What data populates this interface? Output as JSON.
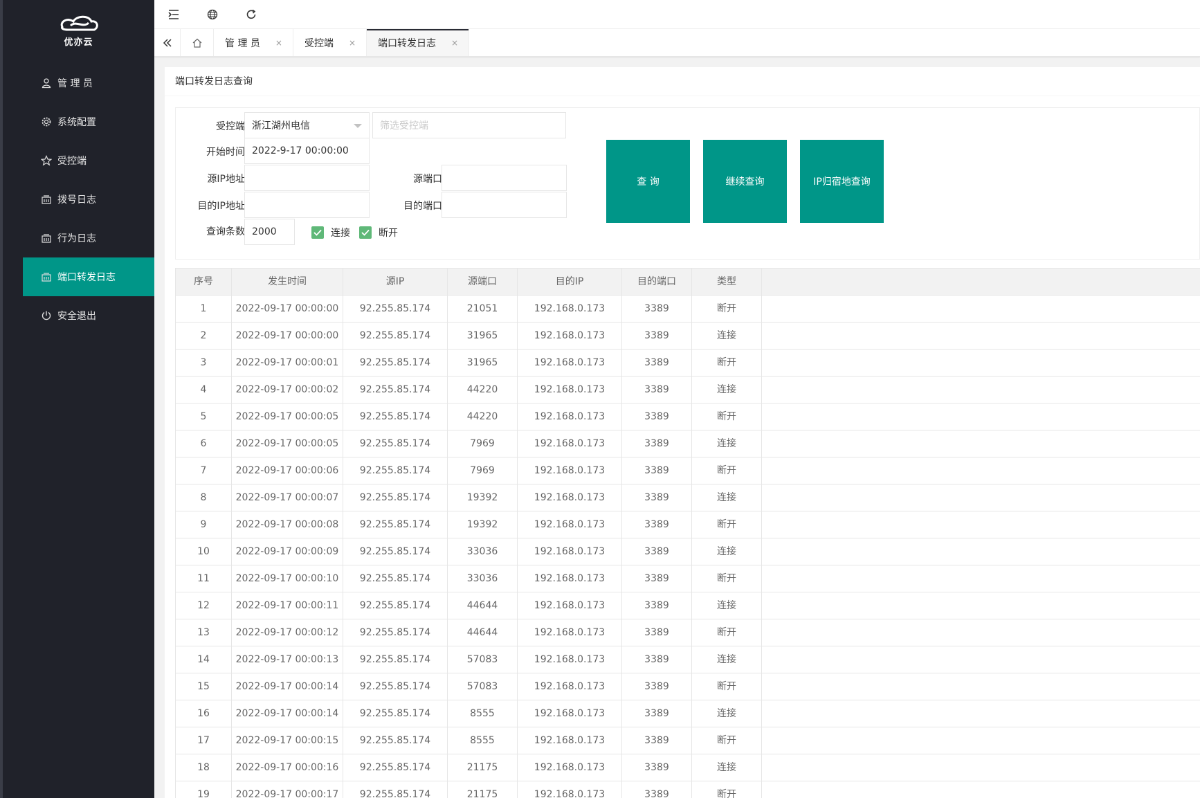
{
  "app": {
    "logo_text": "优亦云"
  },
  "sidebar": {
    "items": [
      {
        "label": "管 理 员",
        "icon": "user-icon",
        "active": false
      },
      {
        "label": "系统配置",
        "icon": "gear-icon",
        "active": false
      },
      {
        "label": "受控端",
        "icon": "star-icon",
        "active": false
      },
      {
        "label": "拨号日志",
        "icon": "log-icon",
        "active": false
      },
      {
        "label": "行为日志",
        "icon": "log-icon",
        "active": false
      },
      {
        "label": "端口转发日志",
        "icon": "log-icon",
        "active": true
      },
      {
        "label": "安全退出",
        "icon": "power-icon",
        "active": false
      }
    ]
  },
  "header": {
    "icons": [
      "menu-fold-icon",
      "globe-icon",
      "refresh-icon"
    ]
  },
  "tabs": [
    {
      "label": "管 理 员",
      "active": false
    },
    {
      "label": "受控端",
      "active": false
    },
    {
      "label": "端口转发日志",
      "active": true
    }
  ],
  "tab_close": "×",
  "card": {
    "title": "端口转发日志查询"
  },
  "filter": {
    "client_label": "受控端",
    "client_value": "浙江湖州电信",
    "client_filter_placeholder": "筛选受控端",
    "start_label": "开始时间",
    "start_value": "2022-9-17 00:00:00",
    "src_ip_label": "源IP地址",
    "src_ip_value": "",
    "src_port_label": "源端口",
    "src_port_value": "",
    "dst_ip_label": "目的IP地址",
    "dst_ip_value": "",
    "dst_port_label": "目的端口",
    "dst_port_value": "",
    "count_label": "查询条数",
    "count_value": "2000",
    "chk_connect_label": "连接",
    "chk_connect_checked": true,
    "chk_disconnect_label": "断开",
    "chk_disconnect_checked": true,
    "btn_query": "查 询",
    "btn_continue": "继续查询",
    "btn_ip_location": "IP归宿地查询"
  },
  "colors": {
    "accent": "#009688",
    "sidebar": "#20222a",
    "checkbox": "#5fb878"
  },
  "table": {
    "columns": [
      "序号",
      "发生时间",
      "源IP",
      "源端口",
      "目的IP",
      "目的端口",
      "类型"
    ],
    "rows": [
      [
        "1",
        "2022-09-17 00:00:00",
        "92.255.85.174",
        "21051",
        "192.168.0.173",
        "3389",
        "断开"
      ],
      [
        "2",
        "2022-09-17 00:00:00",
        "92.255.85.174",
        "31965",
        "192.168.0.173",
        "3389",
        "连接"
      ],
      [
        "3",
        "2022-09-17 00:00:01",
        "92.255.85.174",
        "31965",
        "192.168.0.173",
        "3389",
        "断开"
      ],
      [
        "4",
        "2022-09-17 00:00:02",
        "92.255.85.174",
        "44220",
        "192.168.0.173",
        "3389",
        "连接"
      ],
      [
        "5",
        "2022-09-17 00:00:05",
        "92.255.85.174",
        "44220",
        "192.168.0.173",
        "3389",
        "断开"
      ],
      [
        "6",
        "2022-09-17 00:00:05",
        "92.255.85.174",
        "7969",
        "192.168.0.173",
        "3389",
        "连接"
      ],
      [
        "7",
        "2022-09-17 00:00:06",
        "92.255.85.174",
        "7969",
        "192.168.0.173",
        "3389",
        "断开"
      ],
      [
        "8",
        "2022-09-17 00:00:07",
        "92.255.85.174",
        "19392",
        "192.168.0.173",
        "3389",
        "连接"
      ],
      [
        "9",
        "2022-09-17 00:00:08",
        "92.255.85.174",
        "19392",
        "192.168.0.173",
        "3389",
        "断开"
      ],
      [
        "10",
        "2022-09-17 00:00:09",
        "92.255.85.174",
        "33036",
        "192.168.0.173",
        "3389",
        "连接"
      ],
      [
        "11",
        "2022-09-17 00:00:10",
        "92.255.85.174",
        "33036",
        "192.168.0.173",
        "3389",
        "断开"
      ],
      [
        "12",
        "2022-09-17 00:00:11",
        "92.255.85.174",
        "44644",
        "192.168.0.173",
        "3389",
        "连接"
      ],
      [
        "13",
        "2022-09-17 00:00:12",
        "92.255.85.174",
        "44644",
        "192.168.0.173",
        "3389",
        "断开"
      ],
      [
        "14",
        "2022-09-17 00:00:13",
        "92.255.85.174",
        "57083",
        "192.168.0.173",
        "3389",
        "连接"
      ],
      [
        "15",
        "2022-09-17 00:00:14",
        "92.255.85.174",
        "57083",
        "192.168.0.173",
        "3389",
        "断开"
      ],
      [
        "16",
        "2022-09-17 00:00:14",
        "92.255.85.174",
        "8555",
        "192.168.0.173",
        "3389",
        "连接"
      ],
      [
        "17",
        "2022-09-17 00:00:15",
        "92.255.85.174",
        "8555",
        "192.168.0.173",
        "3389",
        "断开"
      ],
      [
        "18",
        "2022-09-17 00:00:16",
        "92.255.85.174",
        "21175",
        "192.168.0.173",
        "3389",
        "连接"
      ],
      [
        "19",
        "2022-09-17 00:00:17",
        "92.255.85.174",
        "21175",
        "192.168.0.173",
        "3389",
        "断开"
      ]
    ]
  }
}
